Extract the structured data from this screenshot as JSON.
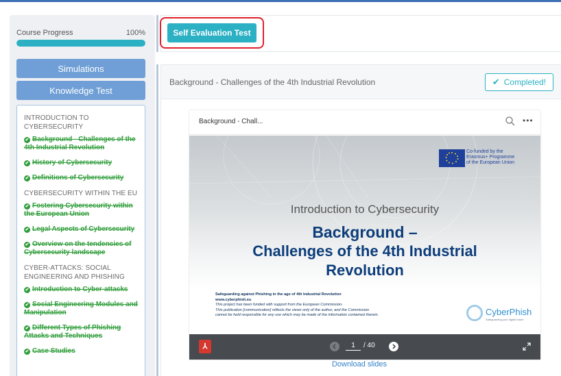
{
  "sidebar": {
    "progress_label": "Course Progress",
    "progress_percent": "100%",
    "progress_fraction": 1.0,
    "buttons": {
      "simulations": "Simulations",
      "knowledge_test": "Knowledge Test"
    },
    "sections": [
      {
        "title": "INTRODUCTION TO CYBERSECURITY",
        "lessons": [
          "Background - Challenges of the 4th Industrial Revolution",
          "History of Cybersecurity",
          "Definitions of Cybersecurity"
        ]
      },
      {
        "title": "CYBERSECURITY WITHIN THE EU",
        "lessons": [
          "Fostering Cybersecurity within the European Union",
          "Legal Aspects of Cybersecurity",
          "Overview on the tendencies of Cybersecurity landscape"
        ]
      },
      {
        "title": "CYBER-ATTACKS: SOCIAL ENGINEERING AND PHISHING",
        "lessons": [
          "Introduction to Cyber-attacks",
          "Social Engineering Modules and Manipulation",
          "Different Types of Phishing Attacks and Techniques",
          "Case Studies"
        ]
      }
    ]
  },
  "main": {
    "self_eval_label": "Self Evaluation Test",
    "content_title": "Background - Challenges of the 4th Industrial Revolution",
    "completed_label": "Completed!",
    "viewer": {
      "title": "Background - Chall...",
      "page_current": "1",
      "page_total": "/ 40"
    },
    "slide": {
      "eu_lines": [
        "Co-funded by the",
        "Erasmus+ Programme",
        "of the European Union"
      ],
      "subtitle": "Introduction to Cybersecurity",
      "title_lines": [
        "Background –",
        "Challenges of the 4th Industrial",
        "Revolution"
      ],
      "foot_bold": "Safeguarding against Phishing in the age of 4th Industrial Revolution",
      "foot_url": "www.cyberphish.eu",
      "foot_lines": [
        "This project has been funded with support from the European Commission.",
        "This publication [communication] reflects the views only of the author, and the Commission",
        "cannot be held responsible for any use which may be made of the information contained therein."
      ],
      "logo_name": "CyberPhish",
      "logo_tagline": "Safeguarding your digital future"
    },
    "download_label": "Download slides"
  },
  "colors": {
    "accent": "#2bb0c4",
    "completed_green": "#2f9d3a",
    "highlight": "#e0202a",
    "side_button": "#6f9fd6"
  }
}
